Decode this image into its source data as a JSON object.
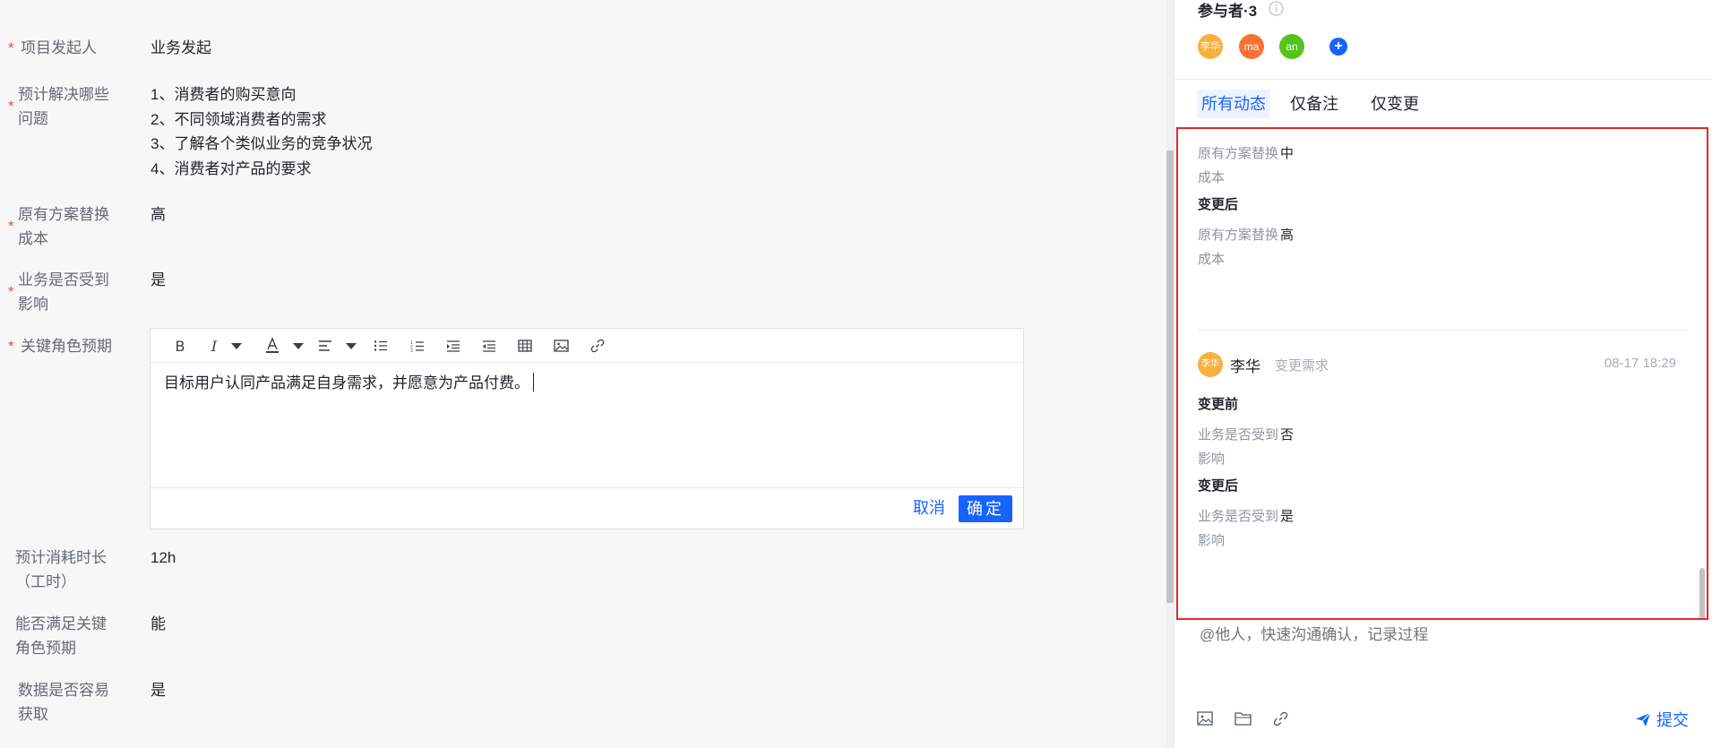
{
  "form": {
    "fields": [
      {
        "label": "项目发起人",
        "required": true,
        "value": "业务发起"
      },
      {
        "label": "预计解决哪些问题",
        "required": true,
        "value_lines": [
          "1、消费者的购买意向",
          "2、不同领域消费者的需求",
          "3、了解各个类似业务的竞争状况",
          "4、消费者对产品的要求"
        ]
      },
      {
        "label": "原有方案替换成本",
        "required": true,
        "value": "高"
      },
      {
        "label": "业务是否受到影响",
        "required": true,
        "value": "是"
      },
      {
        "label": "关键角色预期",
        "required": true
      },
      {
        "label": "预计消耗时长（工时）",
        "required": false,
        "value": "12h"
      },
      {
        "label": "能否满足关键角色预期",
        "required": false,
        "value": "能"
      },
      {
        "label": "数据是否容易获取",
        "required": false,
        "value": "是"
      }
    ],
    "editor": {
      "text": "目标用户认同产品满足自身需求，并愿意为产品付费。",
      "toolbar": [
        "bold-icon",
        "italic-icon",
        "dropdown-icon",
        "font-color-icon",
        "dropdown-icon",
        "align-icon",
        "dropdown-icon",
        "bullet-list-icon",
        "numbered-list-icon",
        "indent-icon",
        "outdent-icon",
        "table-icon",
        "image-icon",
        "link-icon"
      ],
      "cancel_label": "取消",
      "confirm_label": "确定"
    }
  },
  "panel": {
    "participants_title": "参与者·3",
    "participants": [
      {
        "label": "李华",
        "color": "#f8b03e"
      },
      {
        "label": "ma",
        "color": "#f77234"
      },
      {
        "label": "an",
        "color": "#52c41a"
      }
    ],
    "add_label": "+",
    "tabs": [
      "所有动态",
      "仅备注",
      "仅变更"
    ],
    "activities": {
      "first": [
        {
          "field": "原有方案替换成本",
          "value": "中"
        }
      ],
      "first_after_head": "变更后",
      "first_after": [
        {
          "field": "原有方案替换成本",
          "value": "高"
        }
      ],
      "entry": {
        "user": "李华",
        "avatar_label": "李华",
        "action": "变更需求",
        "time": "08-17 18:29",
        "before_head": "变更前",
        "before": [
          {
            "field": "业务是否受到影响",
            "value": "否"
          }
        ],
        "after_head": "变更后",
        "after": [
          {
            "field": "业务是否受到影响",
            "value": "是"
          }
        ]
      }
    },
    "comment_placeholder": "@他人，快速沟通确认，记录过程",
    "submit_label": "提交"
  },
  "colors": {
    "accent": "#1664ff",
    "required": "#f54a45",
    "highlight_border": "#e5282c"
  }
}
